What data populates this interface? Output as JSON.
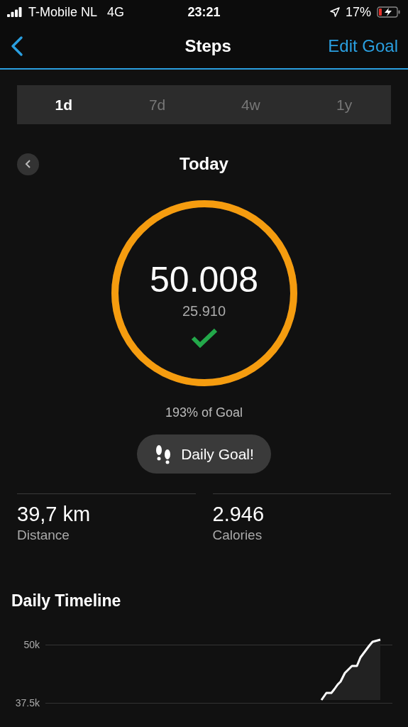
{
  "status_bar": {
    "carrier": "T-Mobile NL",
    "network": "4G",
    "time": "23:21",
    "battery": "17%"
  },
  "nav": {
    "title": "Steps",
    "action": "Edit Goal"
  },
  "tabs": [
    {
      "label": "1d",
      "selected": true
    },
    {
      "label": "7d",
      "selected": false
    },
    {
      "label": "4w",
      "selected": false
    },
    {
      "label": "1y",
      "selected": false
    }
  ],
  "period": {
    "title": "Today"
  },
  "ring": {
    "steps": "50.008",
    "goal": "25.910",
    "level": 1,
    "goal_met": true
  },
  "goal_percent": "193% of Goal",
  "badge": {
    "label": "Daily Goal!"
  },
  "stats": [
    {
      "value": "39,7 km",
      "label": "Distance"
    },
    {
      "value": "2.946",
      "label": "Calories"
    }
  ],
  "timeline": {
    "title": "Daily Timeline",
    "ticks": [
      "50k",
      "37.5k"
    ]
  }
}
